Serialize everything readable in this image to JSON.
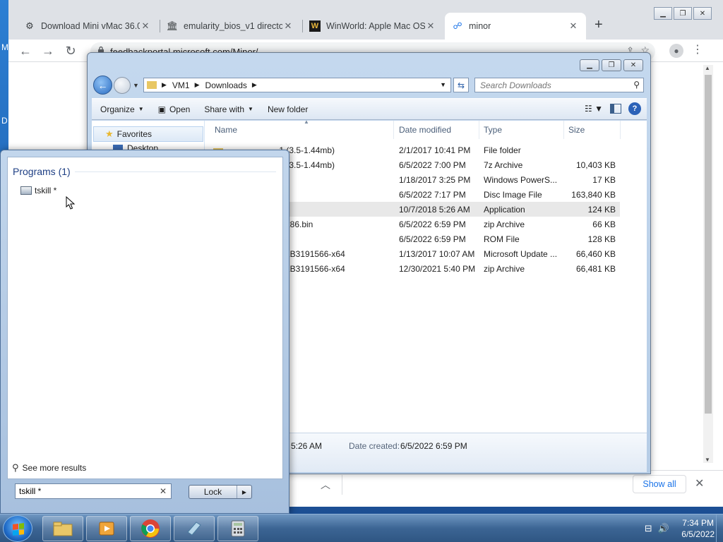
{
  "desktop": {
    "letters": [
      "M",
      "D"
    ]
  },
  "browser": {
    "tabs": [
      {
        "title": "Download Mini vMac 36.0",
        "icon": "mini-vmac-icon"
      },
      {
        "title": "emularity_bios_v1 directo",
        "icon": "archive-org-icon"
      },
      {
        "title": "WinWorld: Apple Mac OS",
        "icon": "winworld-icon"
      },
      {
        "title": "minor",
        "icon": "feedback-hub-icon"
      }
    ],
    "url": "feedbackportal.microsoft.com/Minor/",
    "downloads_bar": {
      "show_all": "Show all"
    }
  },
  "explorer": {
    "breadcrumb": [
      "VM1",
      "Downloads"
    ],
    "search_placeholder": "Search Downloads",
    "commands": {
      "organize": "Organize",
      "open": "Open",
      "share_with": "Share with",
      "new_folder": "New folder"
    },
    "nav": {
      "favorites": "Favorites",
      "desktop": "Desktop"
    },
    "columns": {
      "name": "Name",
      "date": "Date modified",
      "type": "Type",
      "size": "Size"
    },
    "files": [
      {
        "name": "Apple Mac OS 7.1 (3.5-1.44mb)",
        "visible_name": ".1 (3.5-1.44mb)",
        "date": "2/1/2017 10:41 PM",
        "type": "File folder",
        "size": ""
      },
      {
        "name": "",
        "visible_name": ".1 (3.5-1.44mb)",
        "date": "6/5/2022 7:00 PM",
        "type": "7z Archive",
        "size": "10,403 KB"
      },
      {
        "name": "",
        "visible_name": "",
        "date": "1/18/2017 3:25 PM",
        "type": "Windows PowerS...",
        "size": "17 KB"
      },
      {
        "name": "",
        "visible_name": "",
        "date": "6/5/2022 7:17 PM",
        "type": "Disc Image File",
        "size": "163,840 KB"
      },
      {
        "name": "",
        "visible_name": "",
        "date": "10/7/2018 5:26 AM",
        "type": "Application",
        "size": "124 KB"
      },
      {
        "name": "",
        "visible_name": "-wx86.bin",
        "date": "6/5/2022 6:59 PM",
        "type": "zip Archive",
        "size": "66 KB"
      },
      {
        "name": "",
        "visible_name": "",
        "date": "6/5/2022 6:59 PM",
        "type": "ROM File",
        "size": "128 KB"
      },
      {
        "name": "",
        "visible_name": "2-KB3191566-x64",
        "date": "1/13/2017 10:07 AM",
        "type": "Microsoft Update ...",
        "size": "66,460 KB"
      },
      {
        "name": "",
        "visible_name": "2-KB3191566-x64",
        "date": "12/30/2021 5:40 PM",
        "type": "zip Archive",
        "size": "66,481 KB"
      }
    ],
    "selected_row": 4,
    "details": {
      "modified_partial": "5:26 AM",
      "created_label": "Date created:",
      "created_value": "6/5/2022 6:59 PM"
    }
  },
  "start_menu": {
    "section": "Programs (1)",
    "programs": [
      {
        "label": "tskill *",
        "icon": "program-window-icon"
      }
    ],
    "see_more": "See more results",
    "search_value": "tskill *",
    "lock_label": "Lock"
  },
  "taskbar": {
    "pinned": [
      "explorer-folder-icon",
      "media-player-icon",
      "chrome-icon",
      "notepad-icon",
      "calculator-icon"
    ],
    "time": "7:34 PM",
    "date": "6/5/2022"
  }
}
